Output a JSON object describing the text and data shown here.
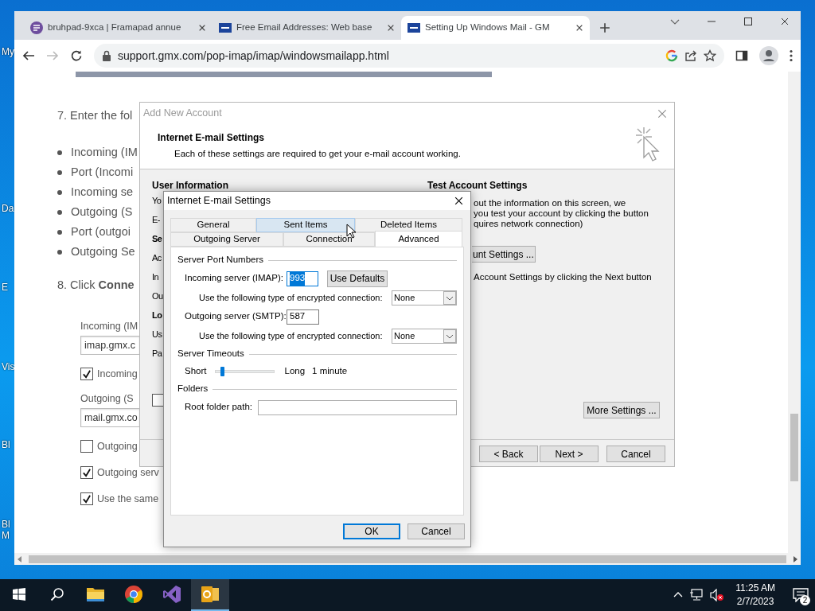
{
  "desktop": {
    "icon_labels": [
      "My",
      "Da",
      "E",
      "Vis",
      "Bl",
      "Bl M"
    ]
  },
  "browser": {
    "tabs": [
      {
        "title": "bruhpad-9xca | Framapad annue",
        "kind": "pad",
        "selected": false
      },
      {
        "title": "Free Email Addresses: Web base",
        "kind": "gmx",
        "selected": false
      },
      {
        "title": "Setting Up Windows Mail - GM",
        "kind": "gmx",
        "selected": true
      }
    ],
    "forward_disabled": true,
    "url": "support.gmx.com/pop-imap/imap/windowsmailapp.html"
  },
  "page": {
    "step_7": "7. Enter the fol",
    "bullets": [
      "Incoming (IM",
      "Port (Incomi",
      "Incoming se",
      "Outgoing (S",
      "Port (outgoi",
      "Outgoing Se"
    ],
    "step_8": "8. Click **Conne**",
    "form": [
      {
        "kind": "label",
        "text": "Incoming (IM"
      },
      {
        "kind": "input",
        "value": "imap.gmx.c"
      },
      {
        "kind": "checkbox",
        "label": "Incoming",
        "checked": true
      },
      {
        "kind": "label",
        "text": "Outgoing (S"
      },
      {
        "kind": "input",
        "value": "mail.gmx.co"
      },
      {
        "kind": "checkbox",
        "label": "Outgoing",
        "checked": false
      },
      {
        "kind": "checkbox",
        "label": "Outgoing serv",
        "checked": true
      },
      {
        "kind": "checkbox",
        "label": "Use the same",
        "checked": true
      }
    ]
  },
  "add_account": {
    "title": "Add New Account",
    "header_title": "Internet E-mail Settings",
    "header_subtitle": "Each of these settings are required to get your e-mail account working.",
    "user_heading": "User Information",
    "left_labels": [
      {
        "text": "Yo",
        "bold": false
      },
      {
        "text": "E-",
        "bold": false
      },
      {
        "text": "Se",
        "bold": true
      },
      {
        "text": "Ac",
        "bold": false
      },
      {
        "text": "In",
        "bold": false
      },
      {
        "text": "Ou",
        "bold": false
      },
      {
        "text": "Lo",
        "bold": true
      },
      {
        "text": "Us",
        "bold": false
      },
      {
        "text": "Pa",
        "bold": false
      }
    ],
    "remember_checkbox": {
      "checked": false
    },
    "test_heading": "Test Account Settings",
    "test_lines": [
      "out the information on this screen, we",
      "you test your account by clicking the button",
      "quires network connection)"
    ],
    "test_button": "unt Settings ...",
    "test_note": "Account Settings by clicking the Next button",
    "more_settings": "More Settings ...",
    "buttons": [
      "< Back",
      "Next >",
      "Cancel"
    ]
  },
  "settings_dialog": {
    "title": "Internet E-mail Settings",
    "tab_rows": [
      [
        {
          "label": "General",
          "selected": false,
          "hovered": false
        },
        {
          "label": "Sent Items",
          "selected": false,
          "hovered": true
        },
        {
          "label": "Deleted Items",
          "selected": false,
          "hovered": false
        }
      ],
      [
        {
          "label": "Outgoing Server",
          "selected": false,
          "hovered": false
        },
        {
          "label": "Connection",
          "selected": false,
          "hovered": false
        },
        {
          "label": "Advanced",
          "selected": true,
          "hovered": false
        }
      ]
    ],
    "rows": [
      {
        "kind": "group",
        "label": "Server Port Numbers"
      },
      {
        "kind": "port",
        "label": "Incoming server (IMAP):",
        "value": "993",
        "text_selected": true,
        "button": "Use Defaults"
      },
      {
        "kind": "select",
        "label": "Use the following type of encrypted connection:",
        "value": "None"
      },
      {
        "kind": "port",
        "label": "Outgoing server (SMTP):",
        "value": "587",
        "text_selected": false
      },
      {
        "kind": "select",
        "label": "Use the following type of encrypted connection:",
        "value": "None"
      },
      {
        "kind": "group",
        "label": "Server Timeouts"
      },
      {
        "kind": "slider",
        "min_label": "Short",
        "max_label": "Long",
        "reading": "1 minute",
        "level": 0.1
      },
      {
        "kind": "group",
        "label": "Folders"
      },
      {
        "kind": "path",
        "label": "Root folder path:"
      }
    ],
    "buttons": [
      {
        "label": "OK",
        "default": true
      },
      {
        "label": "Cancel",
        "default": false
      }
    ]
  },
  "taskbar": {
    "apps": [
      {
        "kind": "explorer",
        "active": false
      },
      {
        "kind": "browser",
        "active": false
      },
      {
        "kind": "ide",
        "active": false
      },
      {
        "kind": "mail",
        "active": true
      }
    ],
    "time": "11:25 AM",
    "date": "2/7/2023",
    "notifications": "2"
  }
}
